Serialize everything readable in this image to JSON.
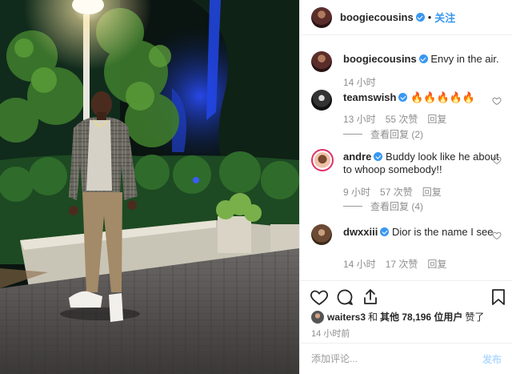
{
  "post": {
    "author": "boogiecousins",
    "follow_label": "关注",
    "dot": "•"
  },
  "comments": [
    {
      "username": "boogiecousins",
      "text": "Envy in the air.",
      "time": "14 小时"
    },
    {
      "username": "teamswish",
      "text": "🔥🔥🔥🔥🔥",
      "time": "13 小时",
      "likes": "55 次赞",
      "reply_label": "回复",
      "view_replies": "查看回复 (2)"
    },
    {
      "username": "andre",
      "text": "Buddy look like he about to whoop somebody!!",
      "time": "9 小时",
      "likes": "57 次赞",
      "reply_label": "回复",
      "view_replies": "查看回复 (4)"
    },
    {
      "username": "dwxxiii",
      "text": "Dior is the name I see",
      "time": "14 小时",
      "likes": "17 次赞",
      "reply_label": "回复"
    }
  ],
  "likes_line": {
    "user": "waiters3",
    "and": "和",
    "others": "其他 78,196 位用户",
    "suffix": "赞了"
  },
  "timestamp": "14 小时前",
  "comment_box": {
    "placeholder": "添加评论...",
    "post_label": "发布"
  },
  "icons": {
    "like": "heart-icon",
    "comment": "comment-icon",
    "share": "share-icon",
    "save": "bookmark-icon",
    "verified": "verified-badge-icon"
  },
  "colors": {
    "accent": "#3897f0",
    "muted": "#8e8e8e",
    "text": "#262626",
    "post_disabled": "#b3dbff"
  }
}
